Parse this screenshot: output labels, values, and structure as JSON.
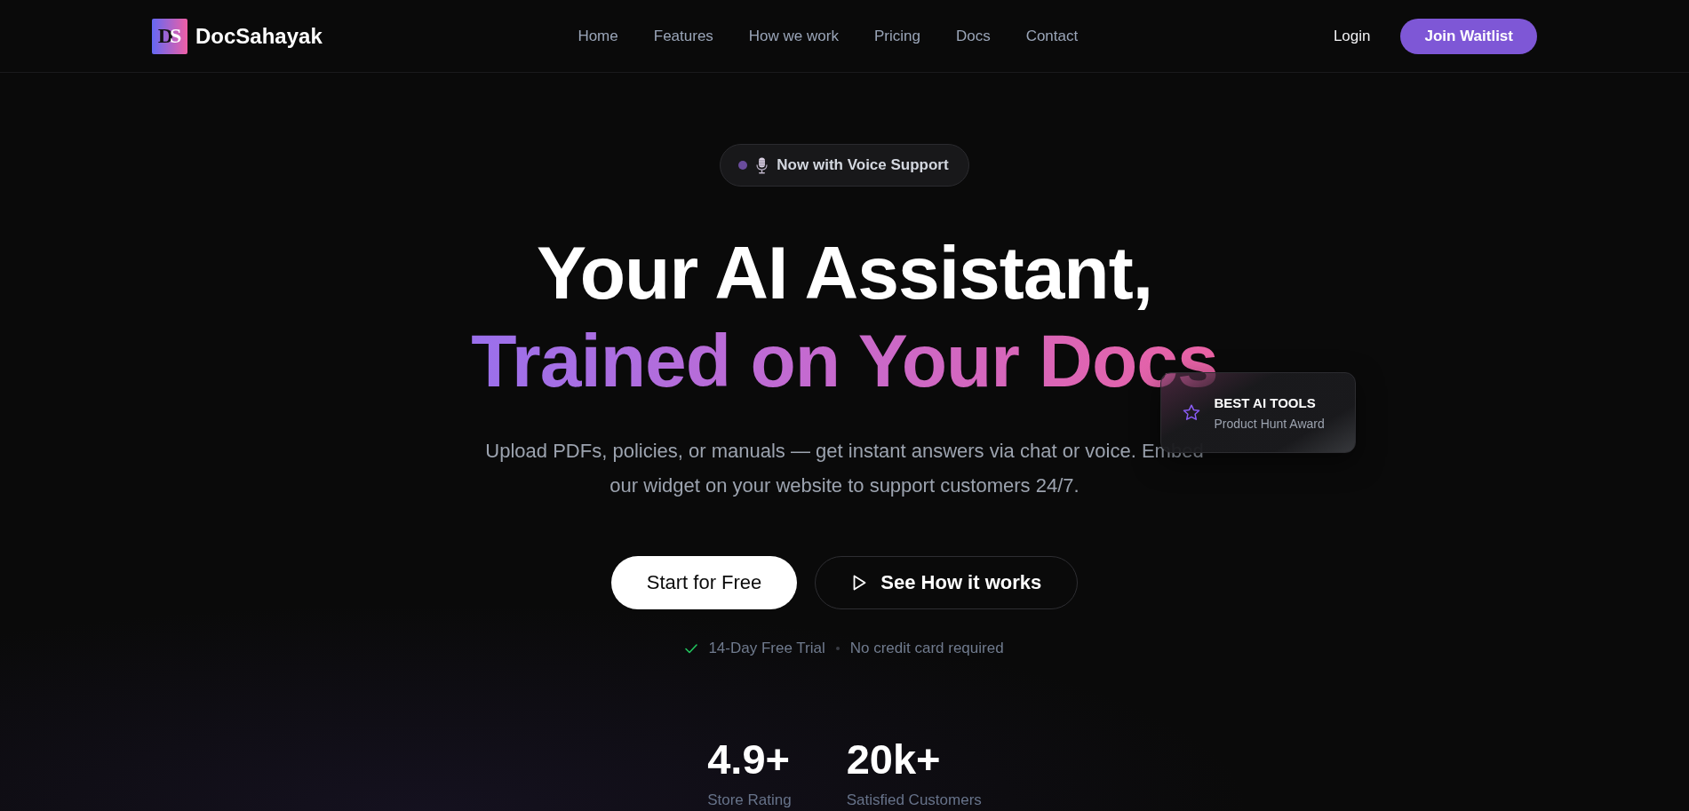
{
  "header": {
    "logo": {
      "mark": "DS",
      "name": "DocSahayak"
    },
    "nav": [
      "Home",
      "Features",
      "How we work",
      "Pricing",
      "Docs",
      "Contact"
    ],
    "login": "Login",
    "cta": "Join Waitlist"
  },
  "hero": {
    "badge": "Now with Voice Support",
    "title_lines": [
      {
        "text": "Your AI Assistant,",
        "kind": "plain"
      },
      {
        "text": "Trained on Your Docs",
        "kind": "gradient"
      }
    ],
    "award": {
      "title": "BEST AI TOOLS",
      "subtitle": "Product Hunt Award"
    },
    "subtitle": "Upload PDFs, policies, or manuals — get instant answers via chat or voice. Embed our widget on your website to support customers 24/7.",
    "buttons": [
      {
        "label": "Start for Free",
        "kind": "primary"
      },
      {
        "label": "See How it works",
        "kind": "secondary"
      }
    ],
    "perks": [
      "14-Day Free Trial",
      "No credit card required"
    ],
    "stats": [
      {
        "value": "4.9+",
        "label": "Store Rating"
      },
      {
        "value": "20k+",
        "label": "Satisfied Customers"
      }
    ]
  }
}
